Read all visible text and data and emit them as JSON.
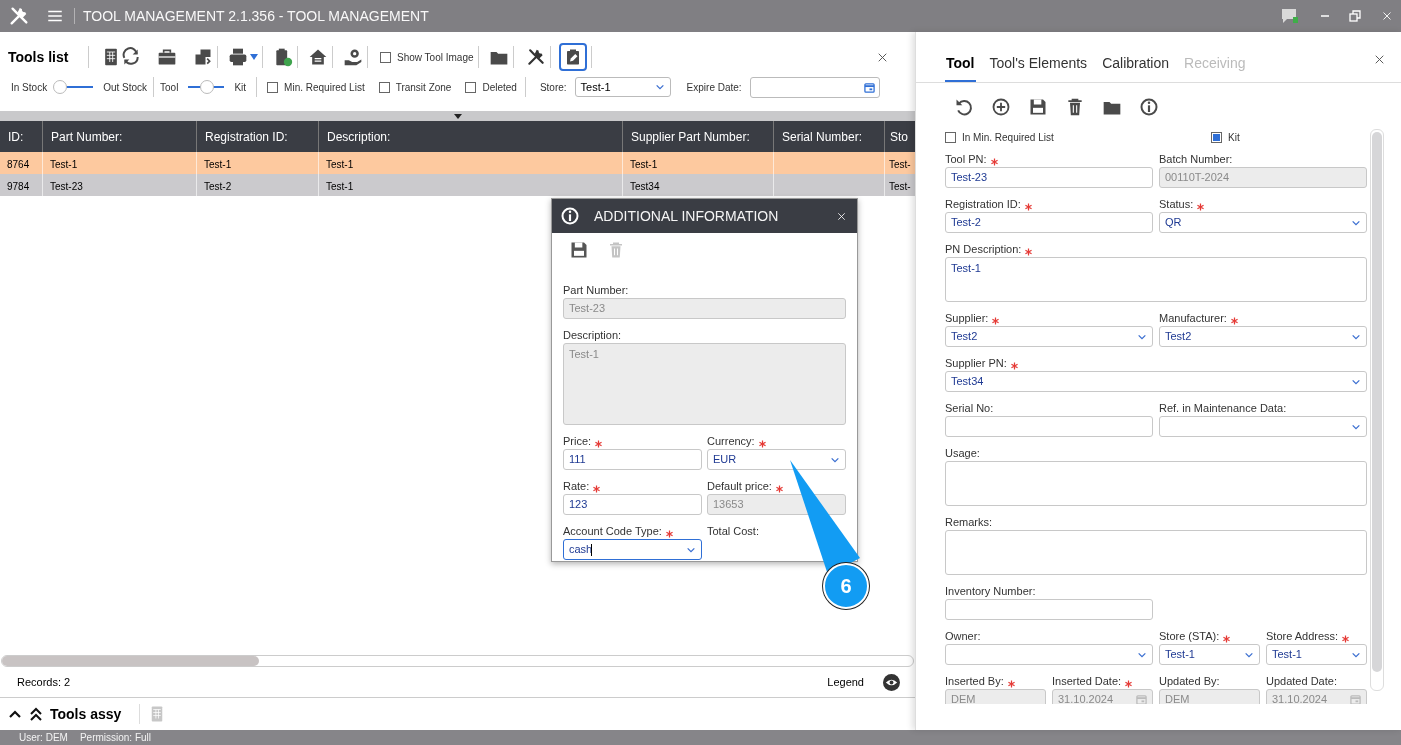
{
  "title_bar": {
    "title": "TOOL MANAGEMENT 2.1.356 - TOOL MANAGEMENT"
  },
  "tools_list": {
    "title": "Tools list",
    "show_tool_image": {
      "label": "Show Tool Image",
      "checked": false
    },
    "toggles": [
      {
        "left_label": "In Stock",
        "right_label": "Out Stock",
        "on": false
      },
      {
        "left_label": "Tool",
        "right_label": "Kit",
        "on": true
      }
    ],
    "checkboxes": [
      {
        "label": "Min. Required List",
        "checked": false
      },
      {
        "label": "Transit Zone",
        "checked": false
      },
      {
        "label": "Deleted",
        "checked": false
      }
    ],
    "store": {
      "label": "Store:",
      "value": "Test-1"
    },
    "expire_date": {
      "label": "Expire Date:"
    },
    "table": {
      "columns": [
        "ID:",
        "Part Number:",
        "Registration ID:",
        "Description:",
        "Supplier Part Number:",
        "Serial Number:",
        "Sto"
      ],
      "rows": [
        {
          "selected": true,
          "cells": [
            "8764",
            "Test-1",
            "Test-1",
            "Test-1",
            "Test-1",
            "",
            "Test-"
          ]
        },
        {
          "selected": false,
          "cells": [
            "9784",
            "Test-23",
            "Test-2",
            "Test-1",
            "Test34",
            "",
            "Test-"
          ]
        }
      ]
    },
    "records": "Records: 2",
    "legend": "Legend"
  },
  "tools_assy": {
    "title": "Tools assy"
  },
  "dialog": {
    "title": "ADDITIONAL INFORMATION",
    "fields": [
      {
        "label": "Part Number:",
        "required": false,
        "kind": "text",
        "value": "Test-23",
        "disabled": true
      },
      {
        "label": "Description:",
        "required": false,
        "kind": "textarea",
        "value": "Test-1",
        "disabled": true
      },
      {
        "label": "Price:",
        "required": true,
        "kind": "text",
        "value": "111",
        "disabled": false
      },
      {
        "label": "Currency:",
        "required": true,
        "kind": "select",
        "value": "EUR",
        "disabled": false
      },
      {
        "label": "Rate:",
        "required": true,
        "kind": "text",
        "value": "123",
        "disabled": false
      },
      {
        "label": "Default price:",
        "required": true,
        "kind": "text",
        "value": "13653",
        "disabled": true
      },
      {
        "label": "Account Code Type:",
        "required": true,
        "kind": "select",
        "value": "cash",
        "disabled": false,
        "focused": true
      },
      {
        "label": "Total Cost:",
        "required": false,
        "kind": "label"
      }
    ]
  },
  "callout": {
    "label": "6"
  },
  "tool_panel": {
    "tabs": [
      {
        "label": "Tool",
        "selected": true,
        "disabled": false
      },
      {
        "label": "Tool's Elements",
        "selected": false,
        "disabled": false
      },
      {
        "label": "Calibration",
        "selected": false,
        "disabled": false
      },
      {
        "label": "Receiving",
        "selected": false,
        "disabled": true
      }
    ],
    "checkboxes": [
      {
        "label": "In Min. Required List",
        "checked": false
      },
      {
        "label": "Kit",
        "checked": true
      }
    ],
    "fields": [
      {
        "label": "Tool PN:",
        "required": true,
        "kind": "text",
        "value": "Test-23",
        "disabled": false
      },
      {
        "label": "Batch Number:",
        "required": false,
        "kind": "text",
        "value": "00110T-2024",
        "disabled": true
      },
      {
        "label": "Registration ID:",
        "required": true,
        "kind": "text",
        "value": "Test-2",
        "disabled": false
      },
      {
        "label": "Status:",
        "required": true,
        "kind": "select",
        "value": "QR",
        "disabled": false
      },
      {
        "label": "PN Description:",
        "required": true,
        "kind": "textarea",
        "value": "Test-1",
        "disabled": false
      },
      {
        "label": "Supplier:",
        "required": true,
        "kind": "select",
        "value": "Test2",
        "disabled": false
      },
      {
        "label": "Manufacturer:",
        "required": true,
        "kind": "select",
        "value": "Test2",
        "disabled": false
      },
      {
        "label": "Supplier PN:",
        "required": true,
        "kind": "select",
        "value": "Test34",
        "disabled": false
      },
      {
        "label": "Serial No:",
        "required": false,
        "kind": "text",
        "disabled": false
      },
      {
        "label": "Ref. in Maintenance Data:",
        "required": false,
        "kind": "select",
        "disabled": false
      },
      {
        "label": "Usage:",
        "required": false,
        "kind": "textarea",
        "disabled": false
      },
      {
        "label": "Remarks:",
        "required": false,
        "kind": "textarea",
        "disabled": false
      },
      {
        "label": "Inventory Number:",
        "required": false,
        "kind": "text",
        "disabled": false
      },
      {
        "label": "Owner:",
        "required": false,
        "kind": "select",
        "disabled": false
      },
      {
        "label": "Store (STA):",
        "required": true,
        "kind": "select",
        "value": "Test-1",
        "disabled": false
      },
      {
        "label": "Store Address:",
        "required": true,
        "kind": "select",
        "value": "Test-1",
        "disabled": false
      },
      {
        "label": "Inserted By:",
        "required": true,
        "kind": "text",
        "value": "DEM",
        "disabled": true
      },
      {
        "label": "Inserted Date:",
        "required": true,
        "kind": "date",
        "value": "31.10.2024",
        "disabled": true
      },
      {
        "label": "Updated By:",
        "required": false,
        "kind": "text",
        "value": "DEM",
        "disabled": true
      },
      {
        "label": "Updated Date:",
        "required": false,
        "kind": "date",
        "value": "31.10.2024",
        "disabled": true
      }
    ]
  },
  "status_bar": {
    "user": "User: DEM",
    "permission": "Permission: Full"
  }
}
